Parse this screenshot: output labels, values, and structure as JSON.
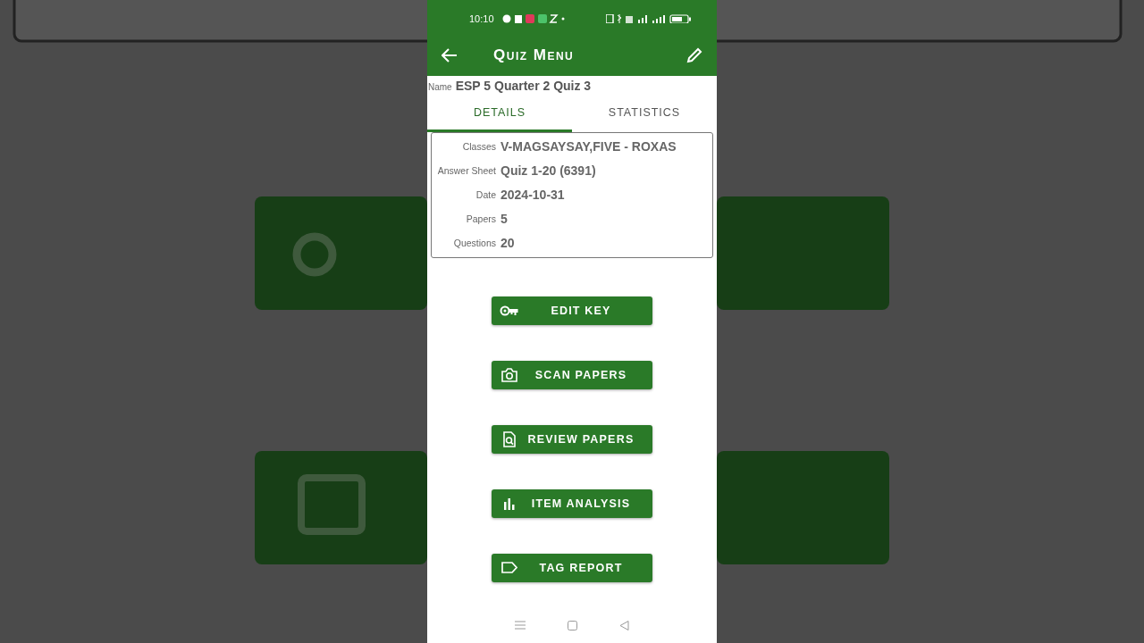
{
  "status_bar": {
    "time": "10:10"
  },
  "app_bar": {
    "title": "Quiz Menu"
  },
  "name": {
    "label": "Name",
    "value": "ESP 5 Quarter 2 Quiz 3"
  },
  "tabs": [
    {
      "label": "DETAILS",
      "selected": true
    },
    {
      "label": "STATISTICS",
      "selected": false
    }
  ],
  "details": [
    {
      "label": "Classes",
      "value": "V-MAGSAYSAY,FIVE - ROXAS"
    },
    {
      "label": "Answer Sheet",
      "value": "Quiz 1-20 (6391)"
    },
    {
      "label": "Date",
      "value": "2024-10-31"
    },
    {
      "label": "Papers",
      "value": "5"
    },
    {
      "label": "Questions",
      "value": "20"
    }
  ],
  "buttons": [
    {
      "label": "EDIT KEY"
    },
    {
      "label": "SCAN PAPERS"
    },
    {
      "label": "REVIEW PAPERS"
    },
    {
      "label": "ITEM ANALYSIS"
    },
    {
      "label": "TAG REPORT"
    }
  ]
}
